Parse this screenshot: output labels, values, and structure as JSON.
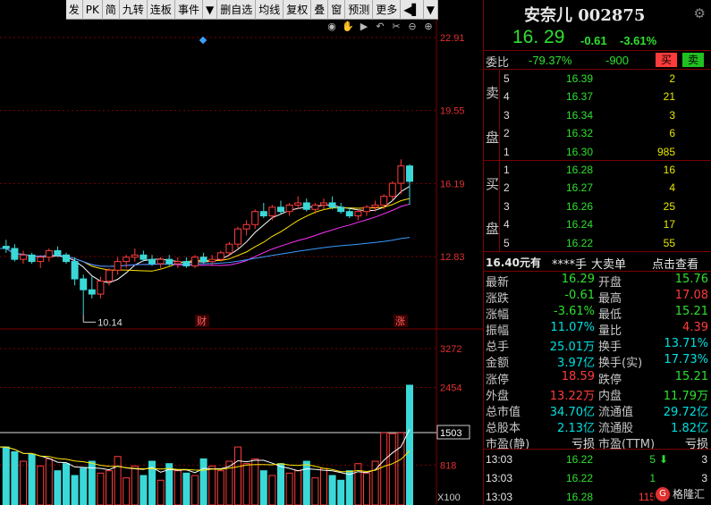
{
  "toolbar": {
    "items": [
      "发",
      "PK",
      "简",
      "九转",
      "连板",
      "事件",
      "▼",
      "删自选",
      "均线",
      "复权",
      "叠",
      "窗",
      "预测",
      "更多",
      "◀▌",
      "▼"
    ]
  },
  "icons": [
    "eye-icon",
    "pan-icon",
    "play-icon",
    "undo-icon",
    "scissors-icon",
    "zoom-out-icon",
    "zoom-in-icon"
  ],
  "chart": {
    "price_axis": [
      "22.91",
      "19.55",
      "16.19",
      "12.83"
    ],
    "low_marker": "10.14",
    "event_labels": [
      "财",
      "涨"
    ],
    "volume_axis": [
      "3272",
      "2454",
      "1503",
      "818"
    ],
    "volume_unit": "X100",
    "colors": {
      "up": "#ff3b3b",
      "down": "#3bd8d8",
      "ma5": "#ffffff",
      "ma10": "#ffe600",
      "ma20": "#ff33ff",
      "ma60": "#3b9bff"
    }
  },
  "chart_data": {
    "type": "candlestick",
    "candles": [
      [
        13.3,
        13.6,
        13.0,
        13.2
      ],
      [
        13.2,
        13.4,
        12.6,
        12.7
      ],
      [
        12.7,
        13.1,
        12.5,
        12.9
      ],
      [
        12.9,
        13.0,
        12.5,
        12.6
      ],
      [
        12.6,
        12.9,
        12.3,
        12.8
      ],
      [
        12.8,
        13.2,
        12.6,
        13.1
      ],
      [
        13.1,
        13.3,
        12.8,
        12.9
      ],
      [
        12.9,
        13.0,
        12.5,
        12.6
      ],
      [
        12.6,
        12.8,
        11.5,
        11.8
      ],
      [
        11.8,
        12.0,
        10.14,
        11.3
      ],
      [
        11.3,
        11.9,
        10.9,
        11.1
      ],
      [
        11.1,
        11.9,
        10.9,
        11.7
      ],
      [
        11.7,
        12.3,
        11.5,
        12.2
      ],
      [
        12.2,
        12.8,
        12.0,
        12.6
      ],
      [
        12.6,
        12.9,
        12.3,
        12.8
      ],
      [
        12.8,
        13.2,
        12.6,
        12.9
      ],
      [
        12.9,
        13.1,
        12.6,
        12.7
      ],
      [
        12.7,
        12.9,
        12.4,
        12.5
      ],
      [
        12.5,
        12.8,
        12.3,
        12.7
      ],
      [
        12.7,
        12.9,
        12.4,
        12.5
      ],
      [
        12.5,
        12.8,
        12.3,
        12.6
      ],
      [
        12.6,
        12.8,
        12.3,
        12.4
      ],
      [
        12.4,
        12.9,
        12.3,
        12.8
      ],
      [
        12.8,
        13.0,
        12.5,
        12.6
      ],
      [
        12.6,
        12.9,
        12.4,
        12.7
      ],
      [
        12.7,
        13.1,
        12.6,
        13.0
      ],
      [
        13.0,
        13.5,
        12.9,
        13.4
      ],
      [
        13.4,
        14.2,
        13.2,
        14.1
      ],
      [
        14.1,
        14.5,
        13.8,
        14.3
      ],
      [
        14.3,
        15.0,
        14.1,
        14.9
      ],
      [
        14.9,
        15.3,
        14.6,
        14.7
      ],
      [
        14.7,
        15.2,
        14.5,
        15.1
      ],
      [
        15.1,
        15.4,
        14.8,
        14.9
      ],
      [
        14.9,
        15.3,
        14.7,
        15.2
      ],
      [
        15.2,
        15.6,
        15.0,
        15.3
      ],
      [
        15.3,
        15.5,
        14.9,
        15.0
      ],
      [
        15.0,
        15.3,
        14.8,
        15.2
      ],
      [
        15.2,
        15.5,
        15.0,
        15.3
      ],
      [
        15.3,
        15.6,
        15.0,
        15.1
      ],
      [
        15.1,
        15.3,
        14.8,
        14.9
      ],
      [
        14.9,
        15.1,
        14.6,
        14.7
      ],
      [
        14.7,
        15.0,
        14.5,
        14.9
      ],
      [
        14.9,
        15.2,
        14.7,
        15.1
      ],
      [
        15.1,
        15.4,
        14.9,
        15.2
      ],
      [
        15.2,
        15.7,
        15.0,
        15.6
      ],
      [
        15.6,
        16.3,
        15.4,
        16.2
      ],
      [
        16.2,
        17.3,
        15.7,
        17.0
      ],
      [
        17.0,
        17.08,
        15.21,
        16.29
      ]
    ],
    "volumes": [
      1200,
      1100,
      900,
      1050,
      800,
      950,
      700,
      850,
      600,
      750,
      900,
      650,
      700,
      1000,
      550,
      800,
      600,
      900,
      500,
      850,
      700,
      650,
      600,
      950,
      800,
      700,
      900,
      1200,
      850,
      950,
      700,
      600,
      850,
      650,
      700,
      900,
      550,
      750,
      600,
      500,
      700,
      850,
      650,
      900,
      1500,
      1480,
      1500,
      2501
    ],
    "volume_up": [
      false,
      false,
      true,
      false,
      true,
      true,
      false,
      false,
      false,
      false,
      false,
      true,
      true,
      true,
      true,
      true,
      false,
      false,
      true,
      false,
      true,
      false,
      true,
      false,
      true,
      true,
      true,
      true,
      true,
      true,
      false,
      true,
      false,
      true,
      true,
      false,
      true,
      true,
      false,
      false,
      false,
      true,
      true,
      true,
      true,
      true,
      true,
      false
    ]
  },
  "panel": {
    "stock_name": "安奈儿 002875",
    "price": "16. 29",
    "change": "-0.61",
    "change_pct": "-3.61%",
    "weibi_label": "委比",
    "weibi_pct": "-79.37%",
    "weicha": "-900",
    "buy_btn": "买",
    "sell_btn": "卖",
    "sell_side": [
      "卖",
      "盘"
    ],
    "buy_side": [
      "买",
      "盘"
    ],
    "asks": [
      {
        "n": "5",
        "p": "16.39",
        "q": "2"
      },
      {
        "n": "4",
        "p": "16.37",
        "q": "21"
      },
      {
        "n": "3",
        "p": "16.34",
        "q": "3"
      },
      {
        "n": "2",
        "p": "16.32",
        "q": "6"
      },
      {
        "n": "1",
        "p": "16.30",
        "q": "985"
      }
    ],
    "bids": [
      {
        "n": "1",
        "p": "16.28",
        "q": "16"
      },
      {
        "n": "2",
        "p": "16.27",
        "q": "4"
      },
      {
        "n": "3",
        "p": "16.26",
        "q": "25"
      },
      {
        "n": "4",
        "p": "16.24",
        "q": "17"
      },
      {
        "n": "5",
        "p": "16.22",
        "q": "55"
      }
    ],
    "pan": {
      "price": "16.40元有",
      "hand": "****手",
      "big": "大卖单",
      "link": "点击查看"
    },
    "stats": [
      {
        "l1": "最新",
        "v1": "16.29",
        "c1": "green",
        "l2": "开盘",
        "v2": "15.76",
        "c2": "green"
      },
      {
        "l1": "涨跌",
        "v1": "-0.61",
        "c1": "green",
        "l2": "最高",
        "v2": "17.08",
        "c2": "red"
      },
      {
        "l1": "涨幅",
        "v1": "-3.61%",
        "c1": "green",
        "l2": "最低",
        "v2": "15.21",
        "c2": "green"
      },
      {
        "l1": "振幅",
        "v1": "11.07%",
        "c1": "cyan",
        "l2": "量比",
        "v2": "4.39",
        "c2": "red"
      },
      {
        "l1": "总手",
        "v1": "25.01万",
        "c1": "cyan",
        "l2": "换手",
        "v2": "13.71%",
        "c2": "cyan"
      },
      {
        "l1": "金额",
        "v1": "3.97亿",
        "c1": "cyan",
        "l2": "换手(实)",
        "v2": "17.73%",
        "c2": "cyan"
      },
      {
        "l1": "涨停",
        "v1": "18.59",
        "c1": "red",
        "l2": "跌停",
        "v2": "15.21",
        "c2": "green"
      },
      {
        "l1": "外盘",
        "v1": "13.22万",
        "c1": "red",
        "l2": "内盘",
        "v2": "11.79万",
        "c2": "green"
      },
      {
        "l1": "总市值",
        "v1": "34.70亿",
        "c1": "cyan",
        "l2": "流通值",
        "v2": "29.72亿",
        "c2": "cyan"
      },
      {
        "l1": "总股本",
        "v1": "2.13亿",
        "c1": "cyan",
        "l2": "流通股",
        "v2": "1.82亿",
        "c2": "cyan"
      },
      {
        "l1": "市盈(静)",
        "v1": "亏损",
        "c1": "white",
        "l2": "市盈(TTM)",
        "v2": "亏损",
        "c2": "white"
      }
    ],
    "ticks": [
      {
        "time": "13:03",
        "price": "16.22",
        "vol": "5",
        "dir": "down",
        "n": "3"
      },
      {
        "time": "13:03",
        "price": "16.22",
        "vol": "1",
        "dir": "",
        "n": "3"
      },
      {
        "time": "13:03",
        "price": "16.28",
        "vol": "115",
        "dir": "up",
        "n": ""
      }
    ],
    "logo": "格隆汇"
  }
}
